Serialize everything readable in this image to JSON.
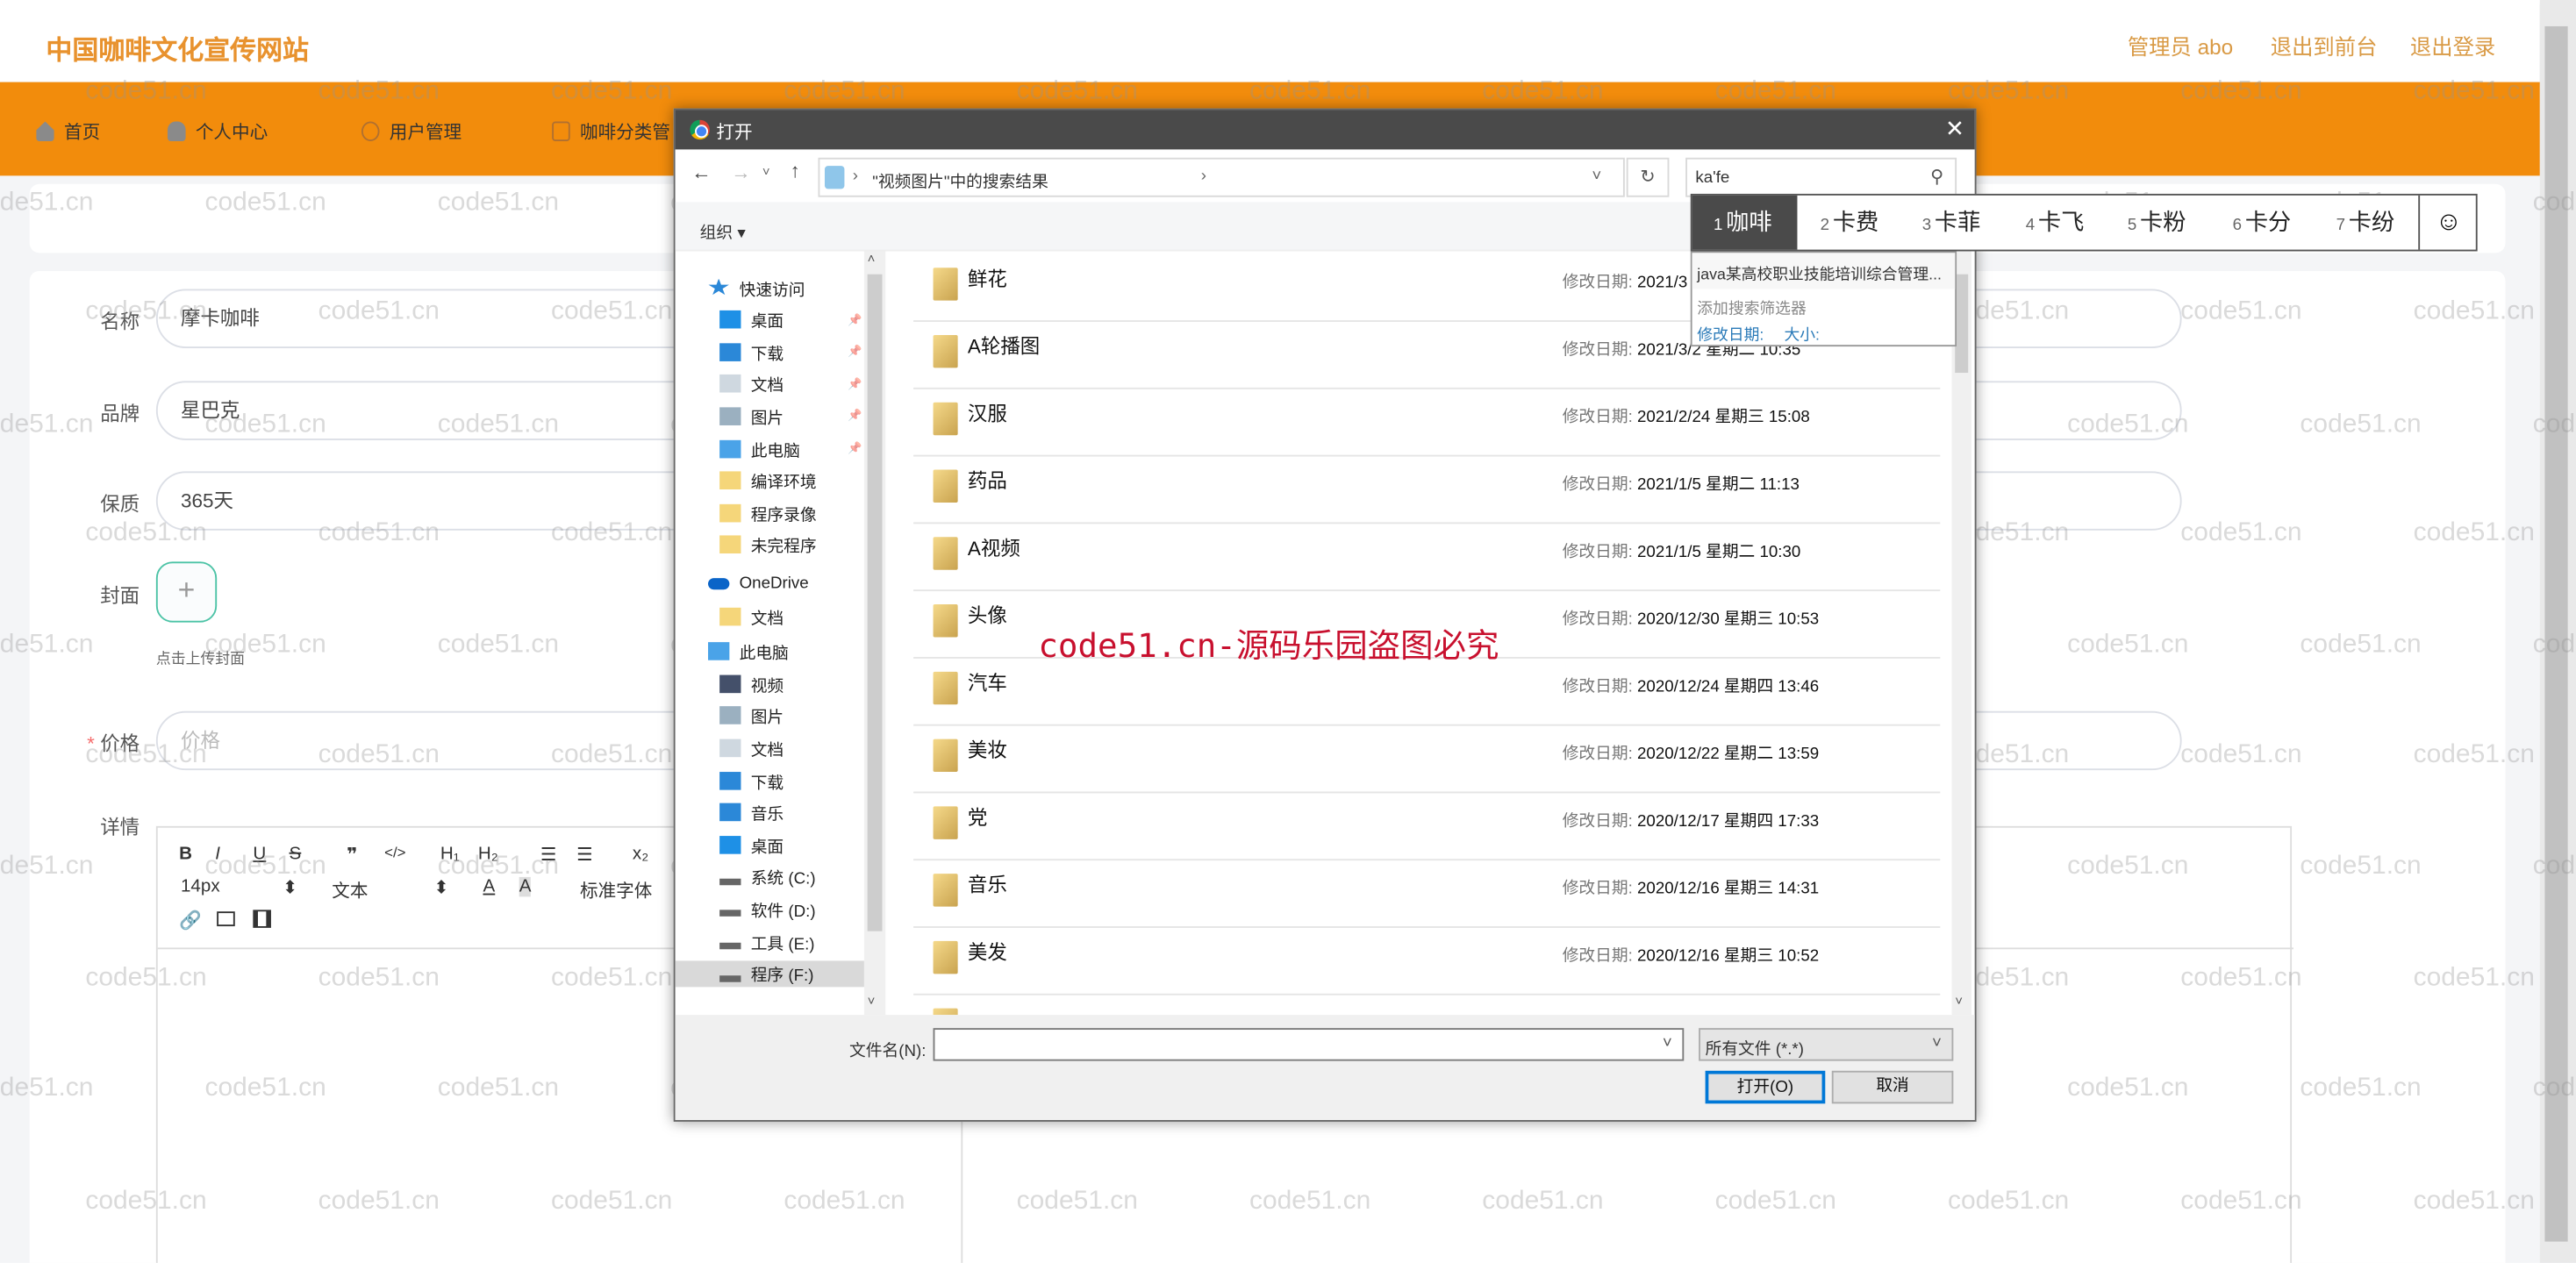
{
  "watermark": "code51.cn",
  "red_watermark": "code51.cn-源码乐园盗图必究",
  "header": {
    "title": "中国咖啡文化宣传网站",
    "links": [
      "管理员 abo",
      "退出到前台",
      "退出登录"
    ]
  },
  "nav": {
    "items": [
      {
        "label": "首页",
        "icon": "home-icon"
      },
      {
        "label": "个人中心",
        "icon": "user-icon"
      },
      {
        "label": "用户管理",
        "icon": "power-icon"
      },
      {
        "label": "咖啡分类管",
        "icon": "list-icon"
      }
    ]
  },
  "form": {
    "name_label": "名称",
    "name_value": "摩卡咖啡",
    "brand_label": "品牌",
    "brand_value": "星巴克",
    "shelf_label": "保质",
    "shelf_value": "365天",
    "cover_label": "封面",
    "cover_plus": "+",
    "cover_hint": "点击上传封面",
    "price_required": "*",
    "price_label": "价格",
    "price_placeholder": "价格",
    "detail_label": "详情"
  },
  "editor": {
    "row1": [
      "B",
      "I",
      "U",
      "S",
      "❞",
      "</>",
      "H₁",
      "H₂",
      "☰",
      "☰",
      "x₂"
    ],
    "font_size": "14px",
    "block_type": "文本",
    "font_color": "A",
    "bg_color": "A",
    "font_family": "标准字体"
  },
  "dialog": {
    "title": "打开",
    "address": "\"视频图片\"中的搜索结果",
    "search_value": "ka'fe",
    "organize": "组织 ▾",
    "nav_pane": [
      {
        "label": "快速访问",
        "icon": "star-icon",
        "indent": 0
      },
      {
        "label": "桌面",
        "icon": "desktop-icon",
        "indent": 1,
        "pinned": true
      },
      {
        "label": "下载",
        "icon": "download-icon",
        "indent": 1,
        "pinned": true
      },
      {
        "label": "文档",
        "icon": "document-icon",
        "indent": 1,
        "pinned": true
      },
      {
        "label": "图片",
        "icon": "picture-icon",
        "indent": 1,
        "pinned": true
      },
      {
        "label": "此电脑",
        "icon": "computer-icon",
        "indent": 1,
        "pinned": true
      },
      {
        "label": "编译环境",
        "icon": "folder-icon",
        "indent": 1
      },
      {
        "label": "程序录像",
        "icon": "folder-icon",
        "indent": 1
      },
      {
        "label": "未完程序",
        "icon": "folder-icon",
        "indent": 1
      },
      {
        "label": "OneDrive",
        "icon": "cloud-icon",
        "indent": 0
      },
      {
        "label": "文档",
        "icon": "folder-icon",
        "indent": 1
      },
      {
        "label": "此电脑",
        "icon": "computer-icon",
        "indent": 0
      },
      {
        "label": "视频",
        "icon": "video-icon",
        "indent": 1
      },
      {
        "label": "图片",
        "icon": "picture-icon",
        "indent": 1
      },
      {
        "label": "文档",
        "icon": "document-icon",
        "indent": 1
      },
      {
        "label": "下载",
        "icon": "download-icon",
        "indent": 1
      },
      {
        "label": "音乐",
        "icon": "music-icon",
        "indent": 1
      },
      {
        "label": "桌面",
        "icon": "desktop-icon",
        "indent": 1
      },
      {
        "label": "系统 (C:)",
        "icon": "drive-icon",
        "indent": 1
      },
      {
        "label": "软件 (D:)",
        "icon": "drive-icon",
        "indent": 1
      },
      {
        "label": "工具 (E:)",
        "icon": "drive-icon",
        "indent": 1
      },
      {
        "label": "程序 (F:)",
        "icon": "drive-icon",
        "indent": 1,
        "selected": true
      }
    ],
    "date_key": "修改日期:",
    "files": [
      {
        "name": "鲜花",
        "date": "2021/3"
      },
      {
        "name": "A轮播图",
        "date": "2021/3/2 星期二 10:35"
      },
      {
        "name": "汉服",
        "date": "2021/2/24 星期三 15:08"
      },
      {
        "name": "药品",
        "date": "2021/1/5 星期二 11:13"
      },
      {
        "name": "A视频",
        "date": "2021/1/5 星期二 10:30"
      },
      {
        "name": "头像",
        "date": "2020/12/30 星期三 10:53"
      },
      {
        "name": "汽车",
        "date": "2020/12/24 星期四 13:46"
      },
      {
        "name": "美妆",
        "date": "2020/12/22 星期二 13:59"
      },
      {
        "name": "党",
        "date": "2020/12/17 星期四 17:33"
      },
      {
        "name": "音乐",
        "date": "2020/12/16 星期三 14:31"
      },
      {
        "name": "美发",
        "date": "2020/12/16 星期三 10:52"
      }
    ],
    "filename_label": "文件名(N):",
    "filename_value": "",
    "filter": "所有文件 (*.*)",
    "open_button": "打开(O)",
    "cancel_button": "取消"
  },
  "ime": {
    "candidates": [
      {
        "n": "1",
        "text": "咖啡"
      },
      {
        "n": "2",
        "text": "卡费"
      },
      {
        "n": "3",
        "text": "卡菲"
      },
      {
        "n": "4",
        "text": "卡飞"
      },
      {
        "n": "5",
        "text": "卡粉"
      },
      {
        "n": "6",
        "text": "卡分"
      },
      {
        "n": "7",
        "text": "卡纷"
      }
    ],
    "emoji": "☺"
  },
  "search_dropdown": {
    "suggestion": "java某高校职业技能培训综合管理...",
    "add_filter": "添加搜索筛选器",
    "filters": [
      "修改日期:",
      "大小:"
    ]
  }
}
